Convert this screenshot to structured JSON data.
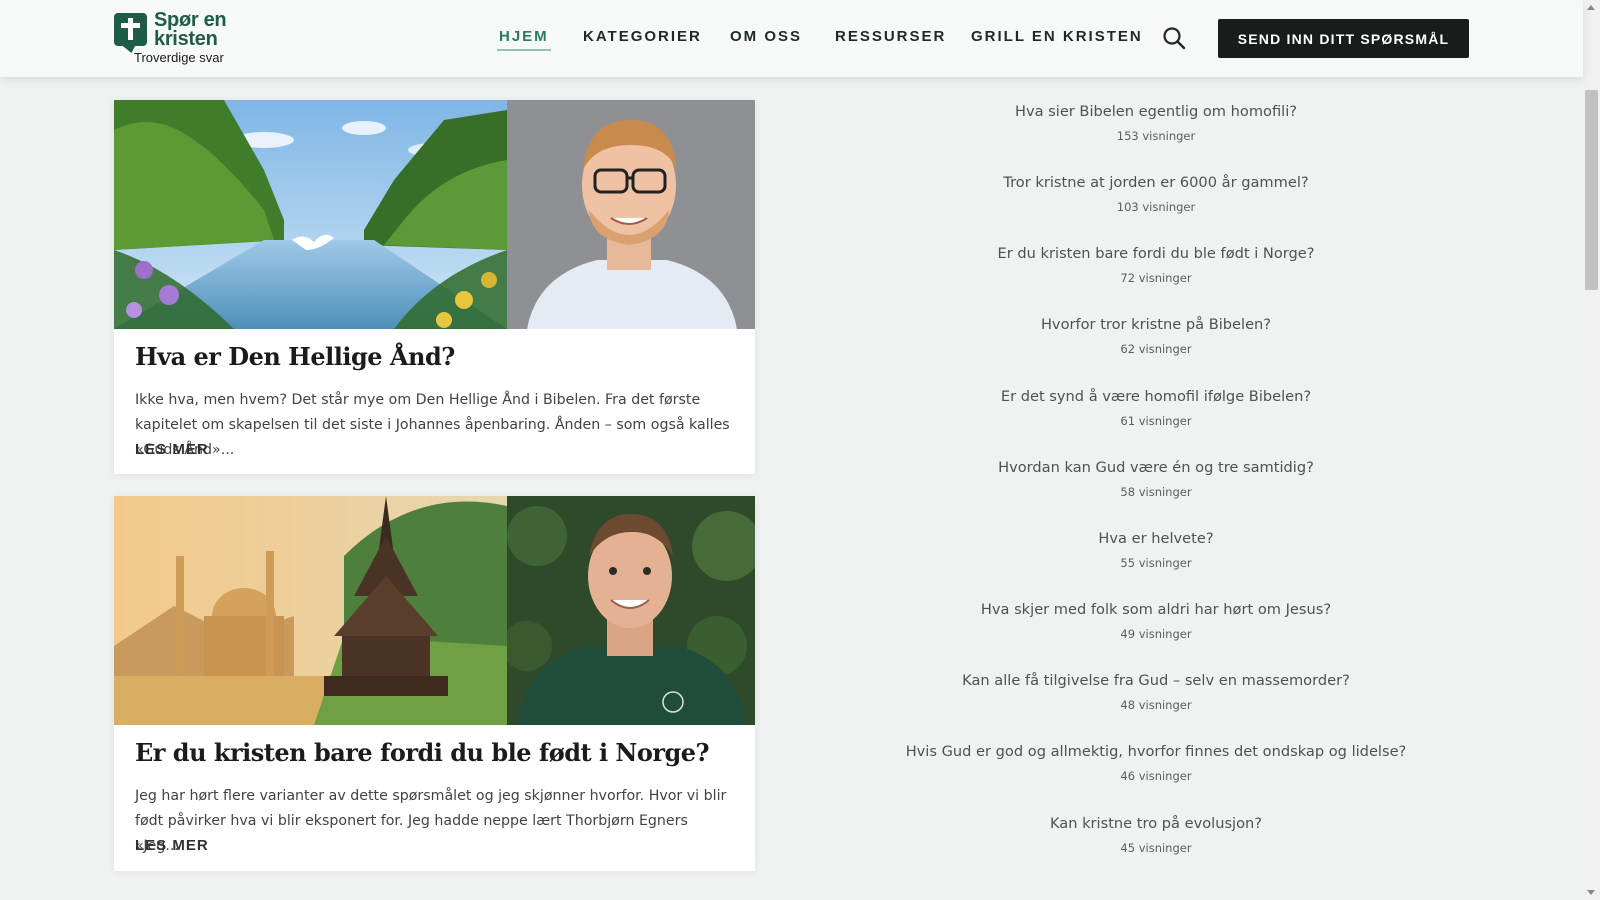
{
  "header": {
    "logo_line1": "Spør en",
    "logo_line2": "kristen",
    "logo_tagline": "Troverdige svar",
    "nav": [
      {
        "label": "HJEM",
        "active": true
      },
      {
        "label": "KATEGORIER",
        "active": false
      },
      {
        "label": "OM OSS",
        "active": false
      },
      {
        "label": "RESSURSER",
        "active": false
      },
      {
        "label": "GRILL EN KRISTEN",
        "active": false
      }
    ],
    "search_icon": "search-icon",
    "cta_label": "SEND INN DITT SPØRSMÅL"
  },
  "posts": [
    {
      "title": "Hva er Den Hellige Ånd?",
      "excerpt": "Ikke hva, men hvem? Det står mye om Den Hellige Ånd i Bibelen. Fra det første kapitelet om skapelsen til det siste i Johannes åpenbaring. Ånden – som også kalles «Guds Ånd»...",
      "read_more": "LES MER"
    },
    {
      "title": "Er du kristen bare fordi du ble født i Norge?",
      "excerpt": "Jeg har hørt flere varianter av dette spørsmålet og jeg skjønner hvorfor. Hvor vi blir født påvirker hva vi blir eksponert for. Jeg hadde neppe lært Thorbjørn Egners «Jeg...",
      "read_more": "LES MER"
    }
  ],
  "popular": [
    {
      "title": "Hva sier Bibelen egentlig om homofili?",
      "views": "153 visninger"
    },
    {
      "title": "Tror kristne at jorden er 6000 år gammel?",
      "views": "103 visninger"
    },
    {
      "title": "Er du kristen bare fordi du ble født i Norge?",
      "views": "72 visninger"
    },
    {
      "title": "Hvorfor tror kristne på Bibelen?",
      "views": "62 visninger"
    },
    {
      "title": "Er det synd å være homofil ifølge Bibelen?",
      "views": "61 visninger"
    },
    {
      "title": "Hvordan kan Gud være én og tre samtidig?",
      "views": "58 visninger"
    },
    {
      "title": "Hva er helvete?",
      "views": "55 visninger"
    },
    {
      "title": "Hva skjer med folk som aldri har hørt om Jesus?",
      "views": "49 visninger"
    },
    {
      "title": "Kan alle få tilgivelse fra Gud – selv en massemorder?",
      "views": "48 visninger"
    },
    {
      "title": "Hvis Gud er god og allmektig, hvorfor finnes det ondskap og lidelse?",
      "views": "46 visninger"
    },
    {
      "title": "Kan kristne tro på evolusjon?",
      "views": "45 visninger"
    }
  ],
  "colors": {
    "brand_green": "#1f5c48",
    "nav_active": "#2b7a5e",
    "cta_bg": "#181c1b",
    "page_bg": "#eef2f1"
  }
}
